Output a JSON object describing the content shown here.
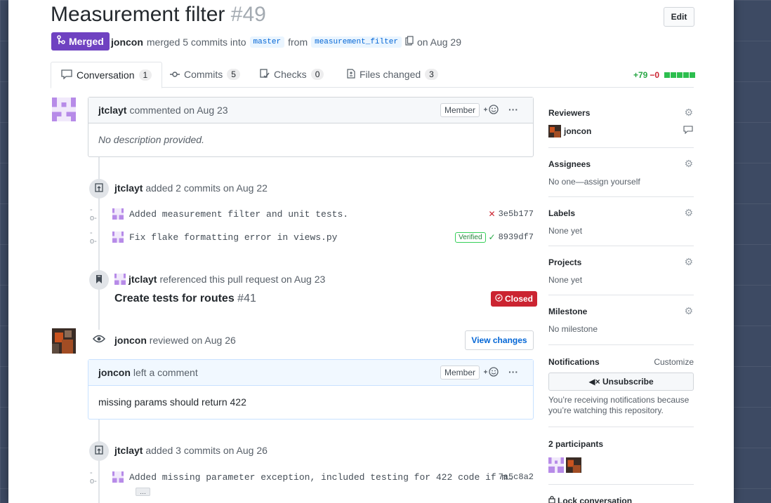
{
  "pr": {
    "title": "Measurement filter",
    "number": "#49",
    "edit_label": "Edit",
    "status": "Merged",
    "author": "joncon",
    "merge_text": "merged 5 commits into",
    "base_branch": "master",
    "from_text": "from",
    "head_branch": "measurement_filter",
    "date_text": "on Aug 29"
  },
  "tabs": [
    {
      "label": "Conversation",
      "count": "1"
    },
    {
      "label": "Commits",
      "count": "5"
    },
    {
      "label": "Checks",
      "count": "0"
    },
    {
      "label": "Files changed",
      "count": "3"
    }
  ],
  "diffstat": {
    "additions": "+79",
    "deletions": "−0"
  },
  "comment1": {
    "author": "jtclayt",
    "action": "commented on Aug 23",
    "role": "Member",
    "body": "No description provided."
  },
  "event_commits1": {
    "author": "jtclayt",
    "action": "added 2 commits on Aug 22",
    "commits": [
      {
        "message": "Added measurement filter and unit tests.",
        "sha": "3e5b177",
        "status": "✕"
      },
      {
        "message": "Fix flake formatting error in views.py",
        "sha": "8939df7",
        "verified": "Verified",
        "status": "✓"
      }
    ]
  },
  "event_ref": {
    "author": "jtclayt",
    "action": "referenced this pull request on Aug 23",
    "issue_title": "Create tests for routes",
    "issue_number": "#41",
    "issue_status": "Closed"
  },
  "event_review": {
    "author": "joncon",
    "action": "reviewed on Aug 26",
    "button": "View changes"
  },
  "comment2": {
    "author": "joncon",
    "action": "left a comment",
    "role": "Member",
    "body": "missing params should return 422"
  },
  "event_commits2": {
    "author": "jtclayt",
    "action": "added 3 commits on Aug 26",
    "commits": [
      {
        "message": "Added missing parameter exception, included testing for 422 code if m…",
        "sha": "7a5c8a2",
        "more": "…"
      }
    ]
  },
  "sidebar": {
    "reviewers": {
      "label": "Reviewers",
      "value": "joncon"
    },
    "assignees": {
      "label": "Assignees",
      "value": "No one—assign yourself"
    },
    "labels": {
      "label": "Labels",
      "value": "None yet"
    },
    "projects": {
      "label": "Projects",
      "value": "None yet"
    },
    "milestone": {
      "label": "Milestone",
      "value": "No milestone"
    },
    "notifications": {
      "label": "Notifications",
      "customize": "Customize",
      "button": "Unsubscribe",
      "note": "You’re receiving notifications because you’re watching this repository."
    },
    "participants": {
      "label": "2 participants"
    },
    "lock": "Lock conversation"
  },
  "colors": {
    "merged": "#6f42c1",
    "closed": "#cb2431",
    "link": "#0366d6",
    "addition": "#28a745"
  }
}
